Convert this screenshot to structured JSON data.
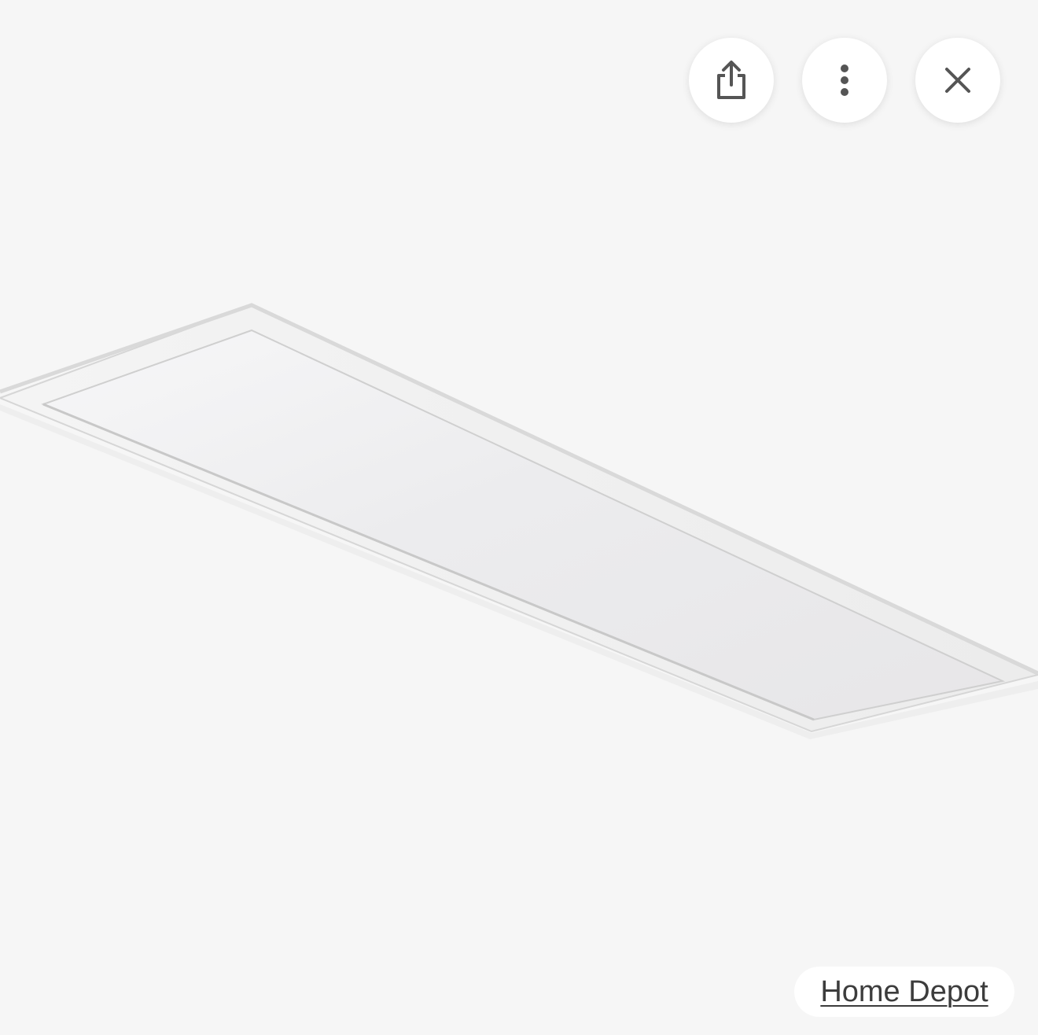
{
  "viewer": {
    "background_color": "#f6f6f6",
    "image": {
      "subject": "flat-led-panel-light"
    }
  },
  "toolbar": {
    "share_icon": "share-icon",
    "more_icon": "more-vertical-icon",
    "close_icon": "close-icon",
    "icon_color": "#555555"
  },
  "source": {
    "label": "Home Depot"
  }
}
